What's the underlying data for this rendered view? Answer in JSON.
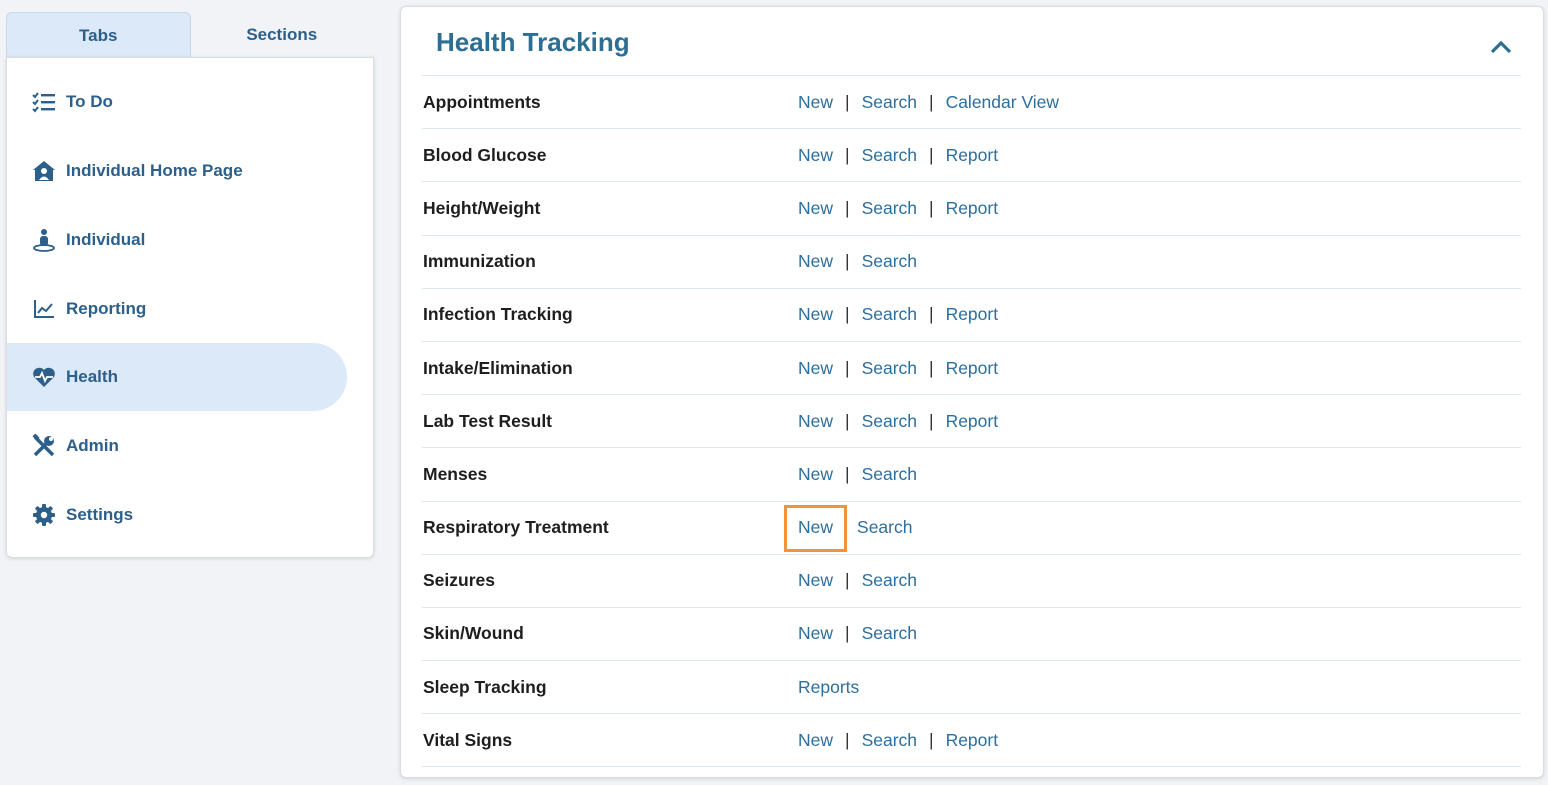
{
  "sidebar": {
    "tabs": [
      {
        "label": "Tabs",
        "active": true
      },
      {
        "label": "Sections",
        "active": false
      }
    ],
    "items": [
      {
        "label": "To Do",
        "icon": "checklist-icon"
      },
      {
        "label": "Individual Home Page",
        "icon": "home-user-icon"
      },
      {
        "label": "Individual",
        "icon": "person-icon"
      },
      {
        "label": "Reporting",
        "icon": "chart-line-icon"
      },
      {
        "label": "Health",
        "icon": "heartbeat-icon",
        "active": true
      },
      {
        "label": "Admin",
        "icon": "tools-icon"
      },
      {
        "label": "Settings",
        "icon": "gear-icon"
      }
    ]
  },
  "main": {
    "title": "Health Tracking",
    "rows": [
      {
        "label": "Appointments",
        "links": [
          "New",
          "Search",
          "Calendar View"
        ]
      },
      {
        "label": "Blood Glucose",
        "links": [
          "New",
          "Search",
          "Report"
        ]
      },
      {
        "label": "Height/Weight",
        "links": [
          "New",
          "Search",
          "Report"
        ]
      },
      {
        "label": "Immunization",
        "links": [
          "New",
          "Search"
        ]
      },
      {
        "label": "Infection Tracking",
        "links": [
          "New",
          "Search",
          "Report"
        ]
      },
      {
        "label": "Intake/Elimination",
        "links": [
          "New",
          "Search",
          "Report"
        ]
      },
      {
        "label": "Lab Test Result",
        "links": [
          "New",
          "Search",
          "Report"
        ]
      },
      {
        "label": "Menses",
        "links": [
          "New",
          "Search"
        ]
      },
      {
        "label": "Respiratory Treatment",
        "links": [
          "New",
          "Search"
        ],
        "highlight": "New"
      },
      {
        "label": "Seizures",
        "links": [
          "New",
          "Search"
        ]
      },
      {
        "label": "Skin/Wound",
        "links": [
          "New",
          "Search"
        ]
      },
      {
        "label": "Sleep Tracking",
        "links": [
          "Reports"
        ]
      },
      {
        "label": "Vital Signs",
        "links": [
          "New",
          "Search",
          "Report"
        ]
      }
    ]
  },
  "colors": {
    "accent": "#2c5f8a",
    "link": "#2c6e9e",
    "highlight": "#f0943c",
    "active_bg": "#dce9f9"
  }
}
